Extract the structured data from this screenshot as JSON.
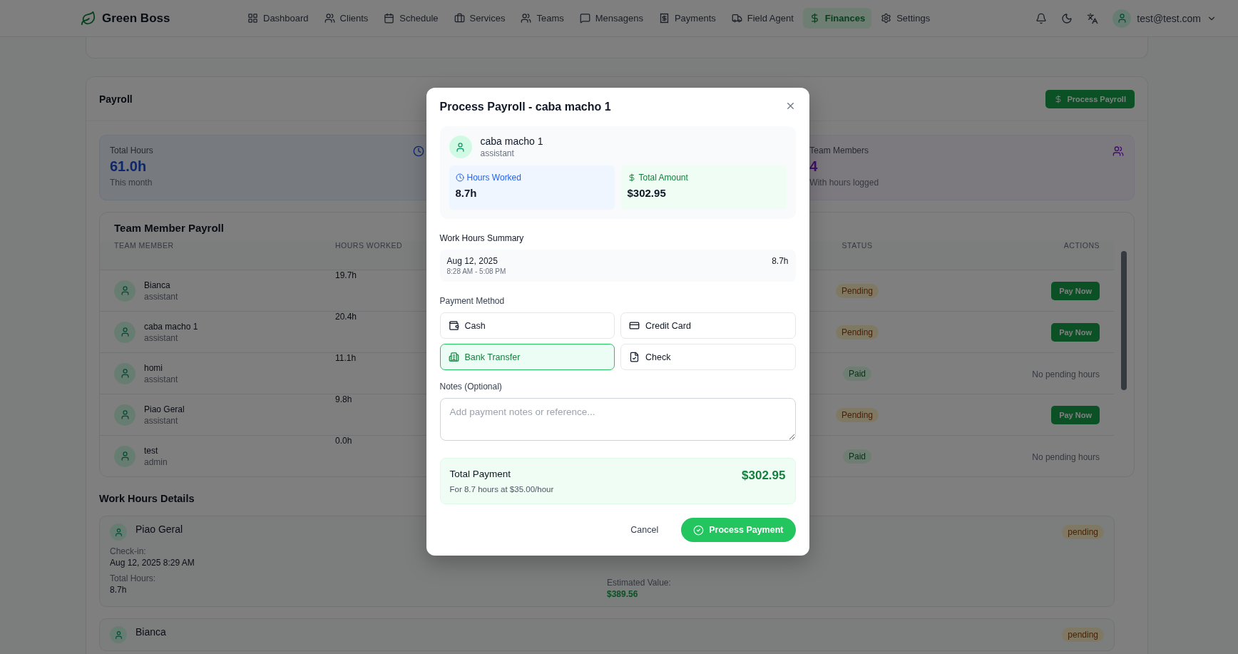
{
  "nav": {
    "brand": "Green Boss",
    "items": [
      {
        "label": "Dashboard",
        "selected": false
      },
      {
        "label": "Clients",
        "selected": false
      },
      {
        "label": "Schedule",
        "selected": false
      },
      {
        "label": "Services",
        "selected": false
      },
      {
        "label": "Teams",
        "selected": false
      },
      {
        "label": "Mensagens",
        "selected": false
      },
      {
        "label": "Payments",
        "selected": false
      },
      {
        "label": "Field Agent",
        "selected": false
      },
      {
        "label": "Finances",
        "selected": true
      },
      {
        "label": "Settings",
        "selected": false
      }
    ],
    "user": "test@test.com"
  },
  "payroll": {
    "title": "Payroll",
    "process_button": "Process Payroll",
    "stats": [
      {
        "kind": "hours",
        "label": "Total Hours",
        "value": "61.0h",
        "note": "This month"
      },
      {
        "kind": "members",
        "label": "Team Members",
        "value": "4",
        "note": "With hours logged"
      }
    ],
    "table": {
      "title": "Team Member Payroll",
      "columns": [
        "TEAM MEMBER",
        "HOURS WORKED",
        "STATUS",
        "ACTIONS"
      ],
      "rows": [
        {
          "name": "Bianca",
          "role": "assistant",
          "hours": "19.7h",
          "status": {
            "label": "Pending",
            "kind": "pending"
          },
          "action": {
            "kind": "button",
            "label": "Pay Now"
          }
        },
        {
          "name": "caba macho 1",
          "role": "assistant",
          "hours": "20.4h",
          "status": {
            "label": "Pending",
            "kind": "pending"
          },
          "action": {
            "kind": "button",
            "label": "Pay Now"
          }
        },
        {
          "name": "homi",
          "role": "assistant",
          "hours": "11.1h",
          "status": {
            "label": "Paid",
            "kind": "paid"
          },
          "action": {
            "kind": "text",
            "label": "No pending hours"
          }
        },
        {
          "name": "Piao Geral",
          "role": "assistant",
          "hours": "9.8h",
          "status": {
            "label": "Pending",
            "kind": "pending"
          },
          "action": {
            "kind": "button",
            "label": "Pay Now"
          }
        },
        {
          "name": "test",
          "role": "admin",
          "hours": "0.0h",
          "status": {
            "label": "Paid",
            "kind": "paid"
          },
          "action": {
            "kind": "text",
            "label": "No pending hours"
          }
        }
      ]
    }
  },
  "work_details": {
    "title": "Work Hours Details",
    "entries": [
      {
        "name": "Piao Geral",
        "status": "pending",
        "left": [
          {
            "label": "Check-in:",
            "value": "Aug 12, 2025 8:29 AM"
          },
          {
            "label": "Total Hours:",
            "value": "8.7h"
          }
        ],
        "right": [
          {
            "label": "Estimated Value:",
            "value": "$389.56"
          }
        ]
      },
      {
        "name": "Bianca",
        "status": "pending"
      }
    ]
  },
  "modal": {
    "title": "Process Payroll - caba macho 1",
    "member": {
      "name": "caba macho 1",
      "role": "assistant"
    },
    "hours_worked": {
      "label": "Hours Worked",
      "value": "8.7h"
    },
    "total_amount": {
      "label": "Total Amount",
      "value": "$302.95"
    },
    "summary_title": "Work Hours Summary",
    "summary_rows": [
      {
        "date": "Aug 12, 2025",
        "range": "8:28 AM - 5:08 PM",
        "hours": "8.7h"
      }
    ],
    "method_title": "Payment Method",
    "methods": [
      {
        "label": "Cash",
        "selected": false
      },
      {
        "label": "Credit Card",
        "selected": false
      },
      {
        "label": "Bank Transfer",
        "selected": true
      },
      {
        "label": "Check",
        "selected": false
      }
    ],
    "notes": {
      "label": "Notes (Optional)",
      "placeholder": "Add payment notes or reference..."
    },
    "total": {
      "label": "Total Payment",
      "value": "$302.95",
      "note": "For 8.7 hours at $35.00/hour"
    },
    "cancel": "Cancel",
    "submit": "Process Payment"
  }
}
